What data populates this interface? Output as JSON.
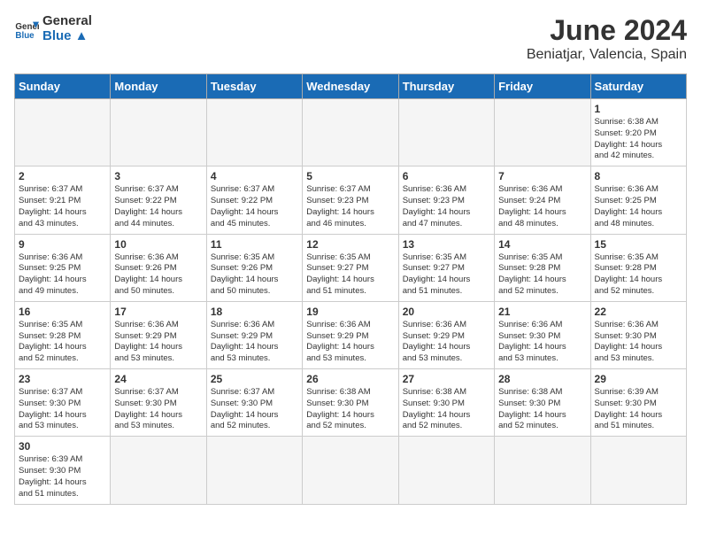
{
  "logo": {
    "line1": "General",
    "line2": "Blue"
  },
  "title": "June 2024",
  "subtitle": "Beniatjar, Valencia, Spain",
  "days_header": [
    "Sunday",
    "Monday",
    "Tuesday",
    "Wednesday",
    "Thursday",
    "Friday",
    "Saturday"
  ],
  "weeks": [
    [
      {
        "day": "",
        "info": ""
      },
      {
        "day": "",
        "info": ""
      },
      {
        "day": "",
        "info": ""
      },
      {
        "day": "",
        "info": ""
      },
      {
        "day": "",
        "info": ""
      },
      {
        "day": "",
        "info": ""
      },
      {
        "day": "1",
        "info": "Sunrise: 6:38 AM\nSunset: 9:20 PM\nDaylight: 14 hours\nand 42 minutes."
      }
    ],
    [
      {
        "day": "2",
        "info": "Sunrise: 6:37 AM\nSunset: 9:21 PM\nDaylight: 14 hours\nand 43 minutes."
      },
      {
        "day": "3",
        "info": "Sunrise: 6:37 AM\nSunset: 9:22 PM\nDaylight: 14 hours\nand 44 minutes."
      },
      {
        "day": "4",
        "info": "Sunrise: 6:37 AM\nSunset: 9:22 PM\nDaylight: 14 hours\nand 45 minutes."
      },
      {
        "day": "5",
        "info": "Sunrise: 6:37 AM\nSunset: 9:23 PM\nDaylight: 14 hours\nand 46 minutes."
      },
      {
        "day": "6",
        "info": "Sunrise: 6:36 AM\nSunset: 9:23 PM\nDaylight: 14 hours\nand 47 minutes."
      },
      {
        "day": "7",
        "info": "Sunrise: 6:36 AM\nSunset: 9:24 PM\nDaylight: 14 hours\nand 48 minutes."
      },
      {
        "day": "8",
        "info": "Sunrise: 6:36 AM\nSunset: 9:25 PM\nDaylight: 14 hours\nand 48 minutes."
      }
    ],
    [
      {
        "day": "9",
        "info": "Sunrise: 6:36 AM\nSunset: 9:25 PM\nDaylight: 14 hours\nand 49 minutes."
      },
      {
        "day": "10",
        "info": "Sunrise: 6:36 AM\nSunset: 9:26 PM\nDaylight: 14 hours\nand 50 minutes."
      },
      {
        "day": "11",
        "info": "Sunrise: 6:35 AM\nSunset: 9:26 PM\nDaylight: 14 hours\nand 50 minutes."
      },
      {
        "day": "12",
        "info": "Sunrise: 6:35 AM\nSunset: 9:27 PM\nDaylight: 14 hours\nand 51 minutes."
      },
      {
        "day": "13",
        "info": "Sunrise: 6:35 AM\nSunset: 9:27 PM\nDaylight: 14 hours\nand 51 minutes."
      },
      {
        "day": "14",
        "info": "Sunrise: 6:35 AM\nSunset: 9:28 PM\nDaylight: 14 hours\nand 52 minutes."
      },
      {
        "day": "15",
        "info": "Sunrise: 6:35 AM\nSunset: 9:28 PM\nDaylight: 14 hours\nand 52 minutes."
      }
    ],
    [
      {
        "day": "16",
        "info": "Sunrise: 6:35 AM\nSunset: 9:28 PM\nDaylight: 14 hours\nand 52 minutes."
      },
      {
        "day": "17",
        "info": "Sunrise: 6:36 AM\nSunset: 9:29 PM\nDaylight: 14 hours\nand 53 minutes."
      },
      {
        "day": "18",
        "info": "Sunrise: 6:36 AM\nSunset: 9:29 PM\nDaylight: 14 hours\nand 53 minutes."
      },
      {
        "day": "19",
        "info": "Sunrise: 6:36 AM\nSunset: 9:29 PM\nDaylight: 14 hours\nand 53 minutes."
      },
      {
        "day": "20",
        "info": "Sunrise: 6:36 AM\nSunset: 9:29 PM\nDaylight: 14 hours\nand 53 minutes."
      },
      {
        "day": "21",
        "info": "Sunrise: 6:36 AM\nSunset: 9:30 PM\nDaylight: 14 hours\nand 53 minutes."
      },
      {
        "day": "22",
        "info": "Sunrise: 6:36 AM\nSunset: 9:30 PM\nDaylight: 14 hours\nand 53 minutes."
      }
    ],
    [
      {
        "day": "23",
        "info": "Sunrise: 6:37 AM\nSunset: 9:30 PM\nDaylight: 14 hours\nand 53 minutes."
      },
      {
        "day": "24",
        "info": "Sunrise: 6:37 AM\nSunset: 9:30 PM\nDaylight: 14 hours\nand 53 minutes."
      },
      {
        "day": "25",
        "info": "Sunrise: 6:37 AM\nSunset: 9:30 PM\nDaylight: 14 hours\nand 52 minutes."
      },
      {
        "day": "26",
        "info": "Sunrise: 6:38 AM\nSunset: 9:30 PM\nDaylight: 14 hours\nand 52 minutes."
      },
      {
        "day": "27",
        "info": "Sunrise: 6:38 AM\nSunset: 9:30 PM\nDaylight: 14 hours\nand 52 minutes."
      },
      {
        "day": "28",
        "info": "Sunrise: 6:38 AM\nSunset: 9:30 PM\nDaylight: 14 hours\nand 52 minutes."
      },
      {
        "day": "29",
        "info": "Sunrise: 6:39 AM\nSunset: 9:30 PM\nDaylight: 14 hours\nand 51 minutes."
      }
    ],
    [
      {
        "day": "30",
        "info": "Sunrise: 6:39 AM\nSunset: 9:30 PM\nDaylight: 14 hours\nand 51 minutes."
      },
      {
        "day": "",
        "info": ""
      },
      {
        "day": "",
        "info": ""
      },
      {
        "day": "",
        "info": ""
      },
      {
        "day": "",
        "info": ""
      },
      {
        "day": "",
        "info": ""
      },
      {
        "day": "",
        "info": ""
      }
    ]
  ]
}
